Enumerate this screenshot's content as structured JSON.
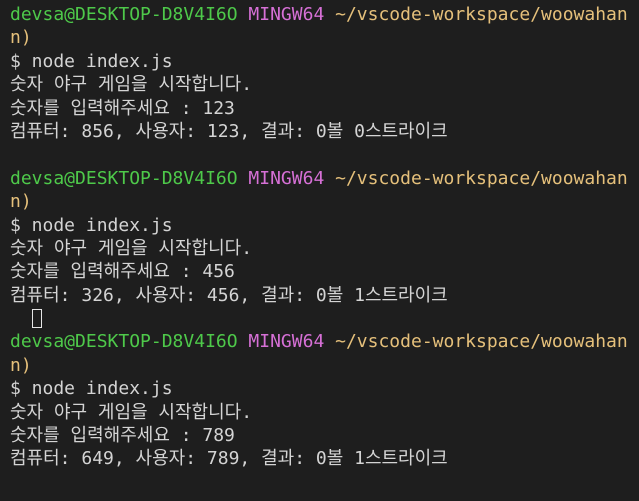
{
  "sessions": [
    {
      "prompt": {
        "user": "devsa@DESKTOP-D8V4I6O",
        "sys": "MINGW64",
        "path": "~/vscode-workspace/woowahan",
        "wrap": "n)"
      },
      "command": "$ node index.js",
      "start": "숫자 야구 게임을 시작합니다.",
      "input": "숫자를 입력해주세요 : 123",
      "result": "컴퓨터: 856, 사용자: 123, 결과: 0볼 0스트라이크"
    },
    {
      "prompt": {
        "user": "devsa@DESKTOP-D8V4I6O",
        "sys": "MINGW64",
        "path": "~/vscode-workspace/woowahan",
        "wrap": "n)"
      },
      "command": "$ node index.js",
      "start": "숫자 야구 게임을 시작합니다.",
      "input": "숫자를 입력해주세요 : 456",
      "result": "컴퓨터: 326, 사용자: 456, 결과: 0볼 1스트라이크"
    },
    {
      "prompt": {
        "user": "devsa@DESKTOP-D8V4I6O",
        "sys": "MINGW64",
        "path": "~/vscode-workspace/woowahan",
        "wrap": "n)"
      },
      "command": "$ node index.js",
      "start": "숫자 야구 게임을 시작합니다.",
      "input": "숫자를 입력해주세요 : 789",
      "result": "컴퓨터: 649, 사용자: 789, 결과: 0볼 1스트라이크"
    }
  ],
  "colors": {
    "background": "#1e1e1e",
    "text": "#d4d4d4",
    "user": "#4ec94a",
    "system": "#d670d6",
    "path": "#e5c07b"
  }
}
